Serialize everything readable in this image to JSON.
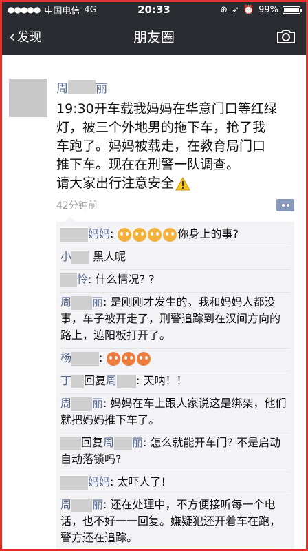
{
  "status_bar": {
    "carrier": "中国电信",
    "network": "4G",
    "time": "20:33",
    "battery": "99%",
    "battery_level": 0.99
  },
  "nav": {
    "back_label": "发现",
    "title": "朋友圈",
    "camera_icon": "camera-icon"
  },
  "post": {
    "author_prefix": "周",
    "author_suffix": "丽",
    "lines": [
      "19:30开车载我妈妈在华意门口等红绿",
      "灯，被三个外地男的拖下车，抢了我",
      "车跑了。妈妈被载走，在教育局门口",
      "推下车。现在在刑警一队调查。",
      "请大家出行注意安全"
    ],
    "time_ago": "42分钟前"
  },
  "comments": [
    {
      "name_suffix": "妈妈",
      "sep": ":",
      "text": "你身上的事?"
    },
    {
      "name_prefix": "小",
      "text": "黑人呢"
    },
    {
      "name_suffix": "怜",
      "sep": ":",
      "text": "什么情况? ?"
    },
    {
      "name_prefix": "周",
      "name_suffix": "丽",
      "sep": ":",
      "text": "是刚刚才发生的。我和妈妈人都没事，车子被开走了，刑警追踪到在汉间方向的路上，遮阳板打开了。"
    },
    {
      "name_prefix": "杨",
      "sep": ":"
    },
    {
      "name_prefix": "丁",
      "reply_word": "回复",
      "reply_prefix": "周",
      "sep": ":",
      "text": "天呐！！"
    },
    {
      "name_prefix": "周",
      "name_suffix": "丽",
      "sep": ":",
      "text": "妈妈在车上跟人家说这是绑架，他们就把妈妈推下车了。"
    },
    {
      "reply_word": "回复",
      "reply_prefix": "周",
      "reply_suffix": "丽",
      "sep": ":",
      "text": "怎么就能开车门? 不是启动自动落锁吗?"
    },
    {
      "name_suffix": "妈妈",
      "sep": ":",
      "text": "太吓人了!"
    },
    {
      "name_prefix": "周",
      "name_suffix": "丽",
      "sep": ":",
      "text": "还在处理中，不方便接听每一个电话，也不好一一回复。嫌疑犯还开着车在跑，警方还在追踪。"
    }
  ]
}
